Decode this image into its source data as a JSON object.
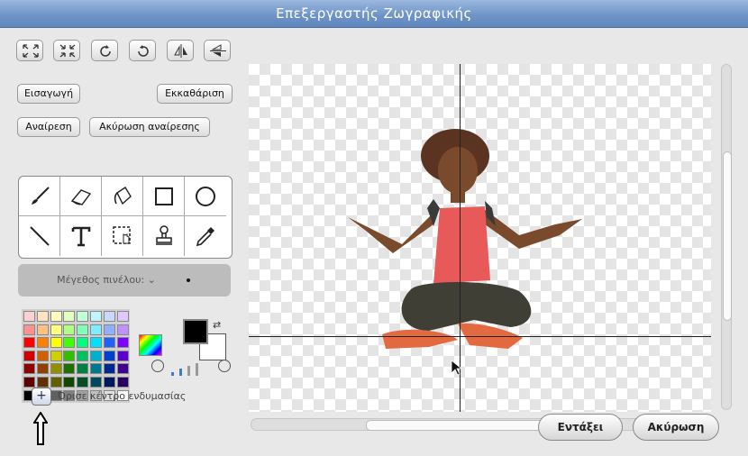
{
  "window": {
    "title": "Επεξεργαστής Ζωγραφικής"
  },
  "toolbar": {
    "icons": [
      "zoom-grow-icon",
      "zoom-shrink-icon",
      "rotate-right-icon",
      "rotate-left-icon",
      "flip-horizontal-icon",
      "flip-vertical-icon"
    ]
  },
  "buttons": {
    "import": "Εισαγωγή",
    "clear": "Εκκαθάριση",
    "undo": "Αναίρεση",
    "redo": "Ακύρωση αναίρεσης",
    "ok": "Εντάξει",
    "cancel": "Ακύρωση"
  },
  "tools": [
    "paintbrush-icon",
    "eraser-icon",
    "fill-bucket-icon",
    "rectangle-icon",
    "ellipse-icon",
    "line-icon",
    "text-icon",
    "select-icon",
    "stamp-icon",
    "eyedropper-icon"
  ],
  "brush": {
    "label": "Μέγεθος πινέλου:",
    "chevron": "⌄"
  },
  "palette": {
    "rows": [
      [
        "#ffd0d0",
        "#ffe2c0",
        "#fffcc0",
        "#e0ffc0",
        "#c0ffd8",
        "#c0f4ff",
        "#c8d8ff",
        "#e0c8ff"
      ],
      [
        "#ff9090",
        "#ffc080",
        "#ffff80",
        "#b0ff80",
        "#80ffb8",
        "#80ecff",
        "#90b0ff",
        "#c090ff"
      ],
      [
        "#ff0000",
        "#ff8000",
        "#ffff00",
        "#40ff00",
        "#00ff80",
        "#00e0ff",
        "#2060ff",
        "#8000ff"
      ],
      [
        "#d00000",
        "#d06000",
        "#d0d000",
        "#30c000",
        "#00c060",
        "#00b0d0",
        "#0040d0",
        "#6000d0"
      ],
      [
        "#900000",
        "#904000",
        "#909000",
        "#207000",
        "#008040",
        "#007890",
        "#002890",
        "#400090"
      ],
      [
        "#600000",
        "#603000",
        "#606000",
        "#104800",
        "#005028",
        "#004860",
        "#001860",
        "#280060"
      ],
      [
        "#000000",
        "#404040",
        "#606060",
        "#808080",
        "#a0a0a0",
        "#c0c0c0",
        "#e0e0e0",
        "#ffffff"
      ]
    ],
    "foreground": "#000000",
    "background": "#ffffff"
  },
  "costume_center": {
    "label": "Όρισε κέντρο ενδυμασίας"
  },
  "canvas": {
    "checker_light": "#ffffff",
    "checker_dark": "#e4e4e4"
  }
}
